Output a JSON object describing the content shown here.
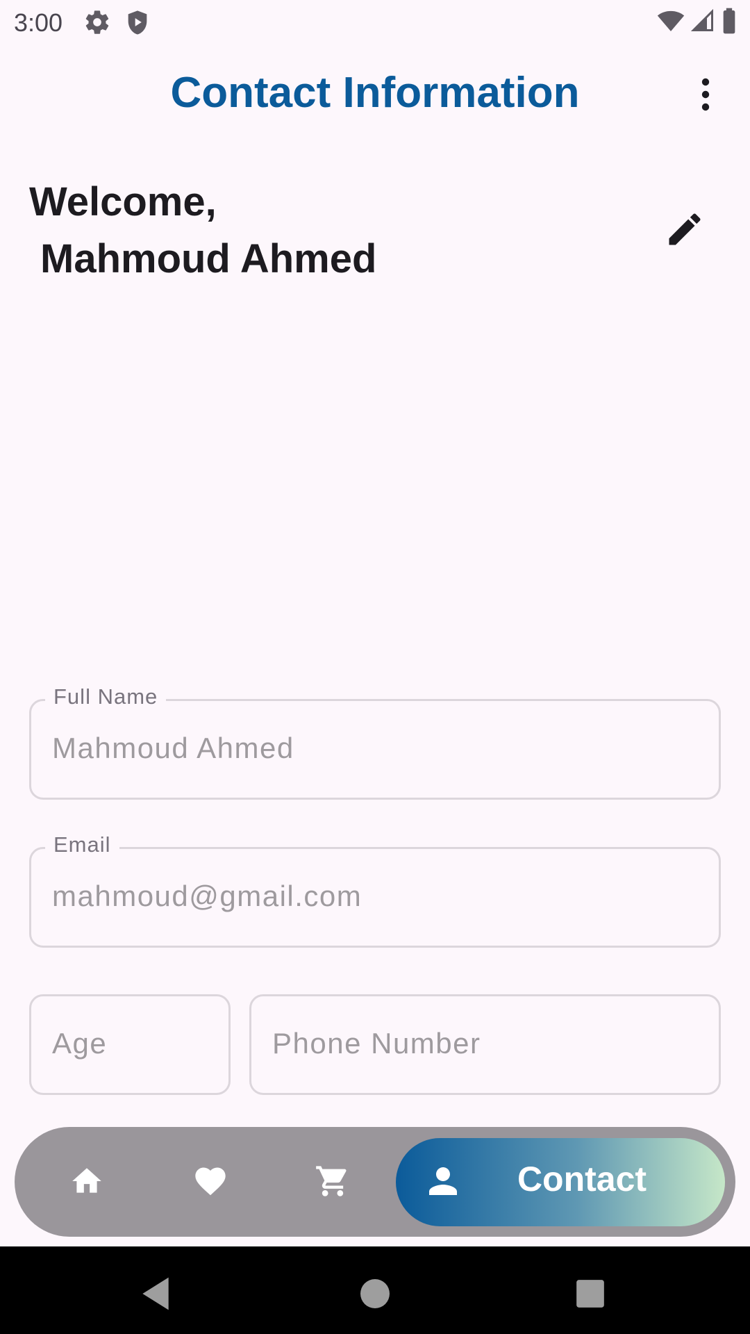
{
  "status_bar": {
    "time": "3:00",
    "left_icons": [
      "gear-icon",
      "shield-icon"
    ],
    "right_icons": [
      "wifi-icon",
      "signal-icon",
      "battery-icon"
    ]
  },
  "app_bar": {
    "title": "Contact Information",
    "menu_icon": "more-vert-icon",
    "title_color": "#0b5b9a"
  },
  "welcome": {
    "greeting": "Welcome,",
    "name": "Mahmoud Ahmed",
    "edit_icon": "pencil-icon"
  },
  "form": {
    "full_name": {
      "label": "Full Name",
      "value": "Mahmoud Ahmed"
    },
    "email": {
      "label": "Email",
      "value": "mahmoud@gmail.com"
    },
    "age": {
      "placeholder": "Age"
    },
    "phone": {
      "placeholder": "Phone Number"
    }
  },
  "bottom_nav": {
    "items": [
      {
        "icon": "home-icon"
      },
      {
        "icon": "heart-icon"
      },
      {
        "icon": "cart-icon"
      },
      {
        "icon": "person-icon",
        "label": "Contact",
        "active": true
      }
    ],
    "background": "#9a969b",
    "active_gradient": [
      "#0b5b9a",
      "#c6e7c8"
    ]
  },
  "system_nav": {
    "buttons": [
      "back-icon",
      "home-circle-icon",
      "recents-icon"
    ]
  }
}
